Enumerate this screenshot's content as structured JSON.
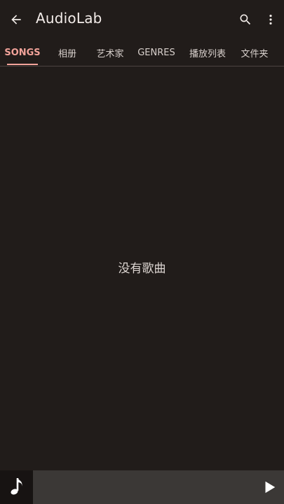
{
  "app_bar": {
    "title": "AudioLab",
    "icons": {
      "back": "back-arrow-icon",
      "search": "search-icon",
      "more": "more-vert-icon"
    }
  },
  "tabs": [
    {
      "label": "SONGS",
      "active": true
    },
    {
      "label": "相册",
      "active": false
    },
    {
      "label": "艺术家",
      "active": false
    },
    {
      "label": "GENRES",
      "active": false
    },
    {
      "label": "播放列表",
      "active": false
    },
    {
      "label": "文件夹",
      "active": false
    }
  ],
  "content": {
    "empty_text": "没有歌曲"
  },
  "player": {
    "art_icon": "music-note-icon",
    "play_icon": "play-icon"
  },
  "colors": {
    "background": "#211c1a",
    "accent": "#f2a39a",
    "player_bar": "#3b3836",
    "text": "#f1ebe8"
  }
}
